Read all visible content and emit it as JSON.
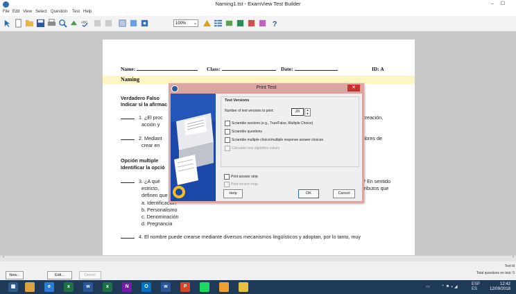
{
  "window": {
    "title": "Naming1.tst - ExamView Test Builder",
    "controls": "– ☐"
  },
  "menu": [
    "File",
    "Edit",
    "View",
    "Select",
    "Question",
    "Test",
    "Help"
  ],
  "toolbar": {
    "zoom": "100%"
  },
  "document": {
    "name_label": "Name:",
    "class_label": "Class:",
    "date_label": "Date:",
    "id_label": "ID: A",
    "section_title": "Naming",
    "section1": {
      "title": "Verdadero Falso",
      "instruction": "Indicar si la afirmac"
    },
    "q1": {
      "num": "1.",
      "line1": "¿El proc",
      "line2": "acción y",
      "right": "creación,"
    },
    "q2": {
      "num": "2.",
      "line1": "Mediant",
      "line2": "crear en",
      "right": "nbres de"
    },
    "section2": {
      "title": "Opción multiple",
      "instruction": "Identificar la opció"
    },
    "q3": {
      "num": "3.",
      "line1": "¿A qué",
      "line2": "estricto,",
      "line3": "definen que y como es.",
      "right1": "? En sentido",
      "right2": "tributos que"
    },
    "q3_options": [
      "a.   Identificación",
      "b.   Personalismo",
      "c.   Denominación",
      "d.   Pregnancia"
    ],
    "q4": {
      "num": "4.",
      "text": "El nombre puede crearse mediante diversos mecanismos lingüísticos y adoptan, por lo tanto, muy"
    }
  },
  "dialog": {
    "title": "Print Test",
    "close": "✕",
    "group_title": "Test Versions",
    "versions_label": "Number of test versions to print:",
    "versions_value": "20",
    "options": [
      {
        "label": "Scramble sections (e.g., True/False, Multiple Choice)",
        "checked": false,
        "enabled": true
      },
      {
        "label": "Scramble questions",
        "checked": false,
        "enabled": true
      },
      {
        "label": "Scramble multiple choice/multiple response answer choices",
        "checked": false,
        "enabled": true
      },
      {
        "label": "Calculate new algorithm values",
        "checked": false,
        "enabled": false
      }
    ],
    "answer_strip": "Print answer strip",
    "version_map": "Print version map",
    "help": "Help",
    "ok": "OK",
    "cancel": "Cancel"
  },
  "bottom": {
    "new": "New...",
    "edit": "Edit...",
    "delete": "Delete",
    "right_top": "Test tit",
    "right_bottom": "Total questions on test: 5"
  },
  "taskbar": {
    "apps": [
      {
        "label": "",
        "color": "#d9a441",
        "icon": "folder-icon"
      },
      {
        "label": "e",
        "color": "#2b7cd3",
        "icon": "edge-icon"
      },
      {
        "label": "x",
        "color": "#1e7145",
        "icon": "excel-icon"
      },
      {
        "label": "w",
        "color": "#2b579a",
        "icon": "word-icon"
      },
      {
        "label": "x",
        "color": "#1e7145",
        "icon": "excel-icon"
      },
      {
        "label": "N",
        "color": "#7719aa",
        "icon": "onenote-icon"
      },
      {
        "label": "O",
        "color": "#0072c6",
        "icon": "outlook-icon"
      },
      {
        "label": "w",
        "color": "#2b579a",
        "icon": "word-icon"
      },
      {
        "label": "P",
        "color": "#d24726",
        "icon": "powerpoint-icon"
      },
      {
        "label": "",
        "color": "#1ed760",
        "icon": "spotify-icon"
      },
      {
        "label": "",
        "color": "#f0a030",
        "icon": "chrome-icon"
      },
      {
        "label": "",
        "color": "#e8c040",
        "icon": "examview-icon"
      }
    ],
    "lang": "ESP",
    "lang2": "ES",
    "time": "12:42",
    "date": "12/09/2018"
  }
}
